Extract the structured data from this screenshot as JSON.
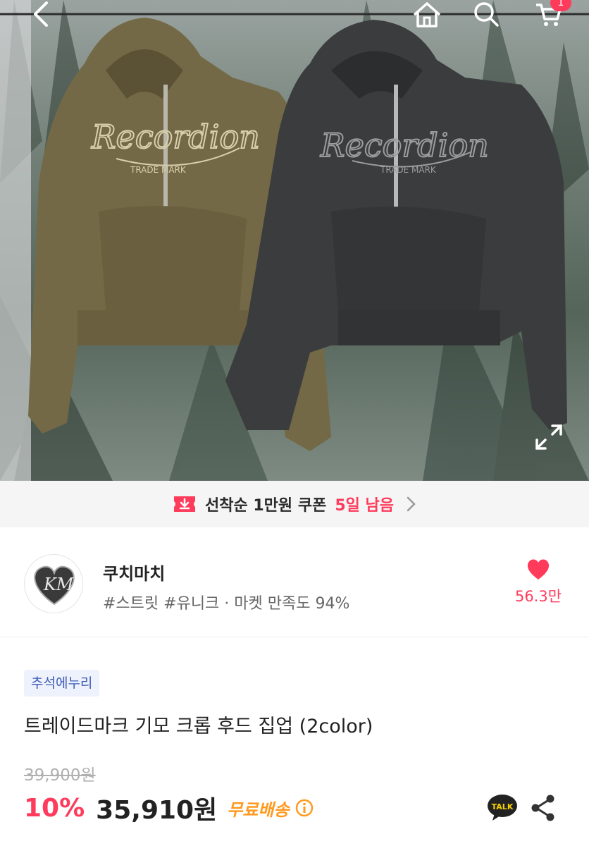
{
  "header": {
    "back_icon": "chevron-left-icon",
    "home_icon": "home-icon",
    "search_icon": "search-icon",
    "cart_icon": "cart-icon",
    "cart_count": "1"
  },
  "hero": {
    "expand_icon": "expand-icon"
  },
  "coupon": {
    "text": "선착순 1만원 쿠폰",
    "days_left": "5일 남음",
    "icon": "coupon-download-icon"
  },
  "seller": {
    "name": "쿠치마치",
    "tags": "#스트릿 #유니크 · 마켓 만족도 94%",
    "likes": "56.3만",
    "like_icon": "heart-icon"
  },
  "product": {
    "promo_badge": "추석에누리",
    "title": "트레이드마크 기모 크롭 후드 집업 (2color)",
    "original_price": "39,900원",
    "discount": "10%",
    "price": "35,910원",
    "shipping": "무료배송"
  },
  "colors": {
    "accent_red": "#ff3b5c",
    "shipping_orange": "#ff9a1f",
    "badge_blue": "#3d5bb8"
  }
}
